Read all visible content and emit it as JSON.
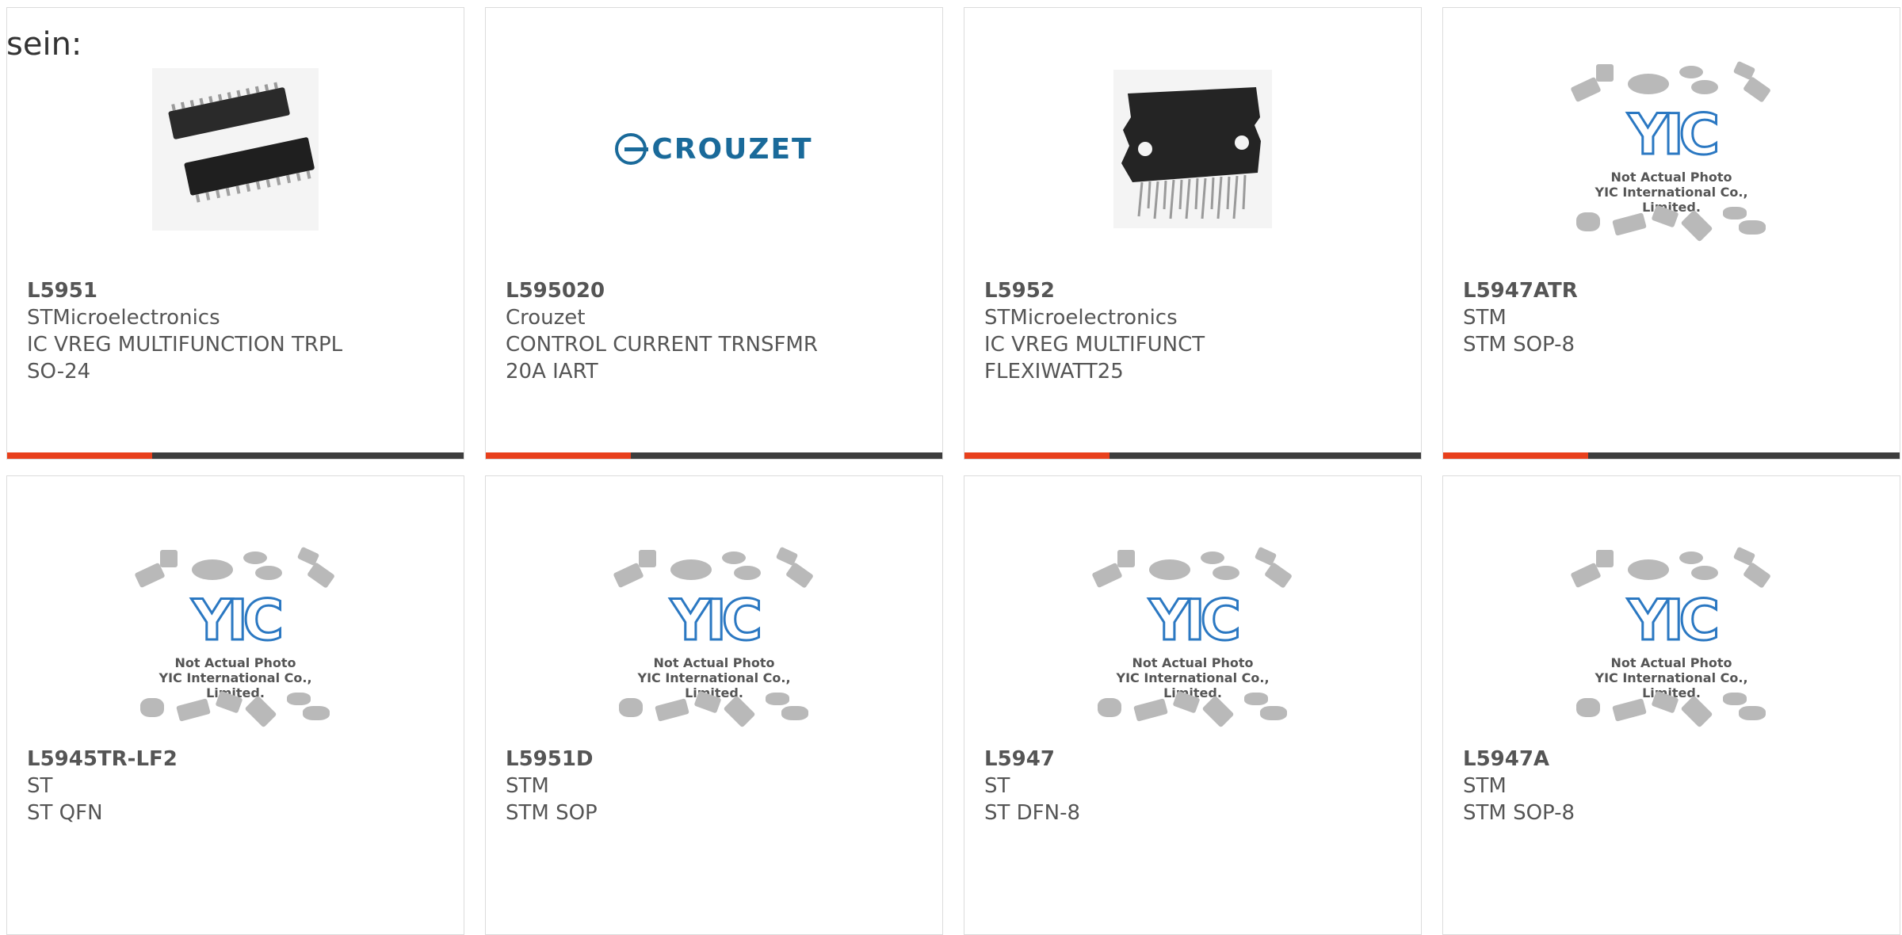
{
  "intro_text": "sein:",
  "colors": {
    "accent": "#e8401c",
    "bar": "#3d3d3d",
    "logo_blue": "#2b78c2"
  },
  "placeholder": {
    "logo": "YIC",
    "line1": "Not Actual Photo",
    "line2": "YIC International Co., Limited."
  },
  "cards": [
    {
      "part": "L5951",
      "maker": "STMicroelectronics",
      "desc1": "IC VREG MULTIFUNCTION TRPL",
      "desc2": "SO-24",
      "image": "soic-chip-photo"
    },
    {
      "part": "L595020",
      "maker": "Crouzet",
      "desc1": "CONTROL CURRENT TRNSFMR",
      "desc2": "20A IART",
      "image": "crouzet-logo",
      "brand_text": "CROUZET"
    },
    {
      "part": "L5952",
      "maker": "STMicroelectronics",
      "desc1": "IC VREG MULTIFUNCT",
      "desc2": "FLEXIWATT25",
      "image": "flexiwatt-chip-photo"
    },
    {
      "part": "L5947ATR",
      "maker": "STM",
      "desc1": "STM SOP-8",
      "desc2": "",
      "image": "yic-placeholder"
    },
    {
      "part": "L5945TR-LF2",
      "maker": "ST",
      "desc1": "ST QFN",
      "desc2": "",
      "image": "yic-placeholder"
    },
    {
      "part": "L5951D",
      "maker": "STM",
      "desc1": "STM SOP",
      "desc2": "",
      "image": "yic-placeholder"
    },
    {
      "part": "L5947",
      "maker": "ST",
      "desc1": "ST DFN-8",
      "desc2": "",
      "image": "yic-placeholder"
    },
    {
      "part": "L5947A",
      "maker": "STM",
      "desc1": "STM SOP-8",
      "desc2": "",
      "image": "yic-placeholder"
    }
  ]
}
